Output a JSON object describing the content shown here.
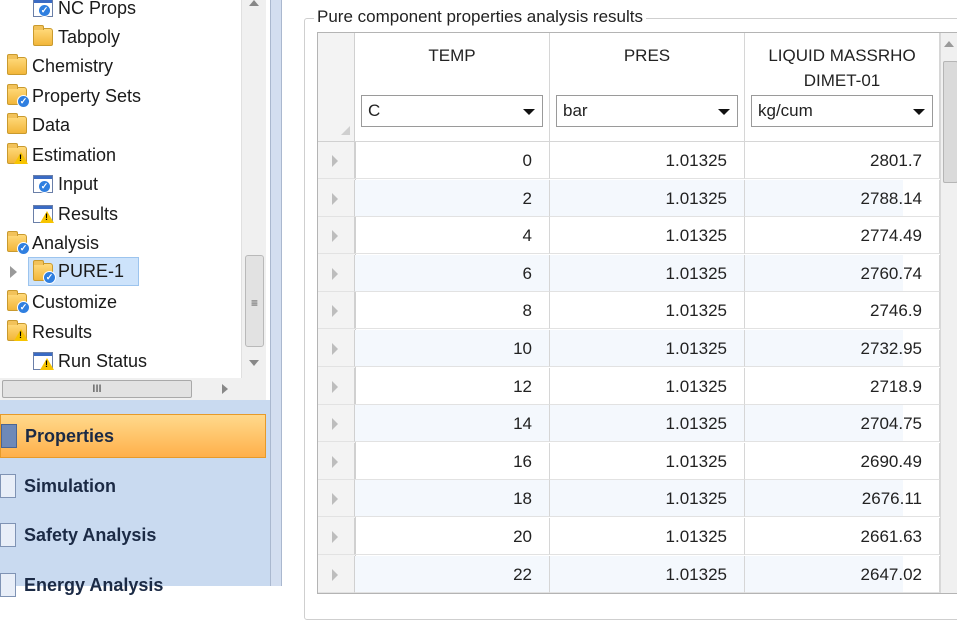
{
  "tree": {
    "items": [
      {
        "label": "NC Props",
        "icon": "form-check-icon"
      },
      {
        "label": "Tabpoly",
        "icon": "folder-icon"
      },
      {
        "label": "Chemistry",
        "icon": "folder-icon"
      },
      {
        "label": "Property Sets",
        "icon": "folder-check-icon"
      },
      {
        "label": "Data",
        "icon": "folder-icon"
      },
      {
        "label": "Estimation",
        "icon": "folder-warning-icon"
      },
      {
        "label": "Input",
        "icon": "form-check-icon"
      },
      {
        "label": "Results",
        "icon": "form-warning-icon"
      },
      {
        "label": "Analysis",
        "icon": "folder-check-icon"
      },
      {
        "label": "PURE-1",
        "icon": "folder-check-icon"
      },
      {
        "label": "Customize",
        "icon": "folder-check-icon"
      },
      {
        "label": "Results",
        "icon": "folder-warning-icon"
      },
      {
        "label": "Run Status",
        "icon": "form-warning-icon"
      }
    ],
    "hscroll_grip": "III"
  },
  "nav": {
    "items": [
      {
        "label": "Properties",
        "active": true
      },
      {
        "label": "Simulation",
        "active": false
      },
      {
        "label": "Safety Analysis",
        "active": false
      },
      {
        "label": "Energy Analysis",
        "active": false
      }
    ]
  },
  "results": {
    "group_title": "Pure component properties analysis results",
    "columns": [
      {
        "header": "TEMP",
        "unit": "C"
      },
      {
        "header": "PRES",
        "unit": "bar"
      },
      {
        "header": "LIQUID MASSRHO DIMET-01",
        "unit": "kg/cum"
      }
    ],
    "rows": [
      [
        "0",
        "1.01325",
        "2801.7"
      ],
      [
        "2",
        "1.01325",
        "2788.14"
      ],
      [
        "4",
        "1.01325",
        "2774.49"
      ],
      [
        "6",
        "1.01325",
        "2760.74"
      ],
      [
        "8",
        "1.01325",
        "2746.9"
      ],
      [
        "10",
        "1.01325",
        "2732.95"
      ],
      [
        "12",
        "1.01325",
        "2718.9"
      ],
      [
        "14",
        "1.01325",
        "2704.75"
      ],
      [
        "16",
        "1.01325",
        "2690.49"
      ],
      [
        "18",
        "1.01325",
        "2676.11"
      ],
      [
        "20",
        "1.01325",
        "2661.63"
      ],
      [
        "22",
        "1.01325",
        "2647.02"
      ]
    ]
  }
}
